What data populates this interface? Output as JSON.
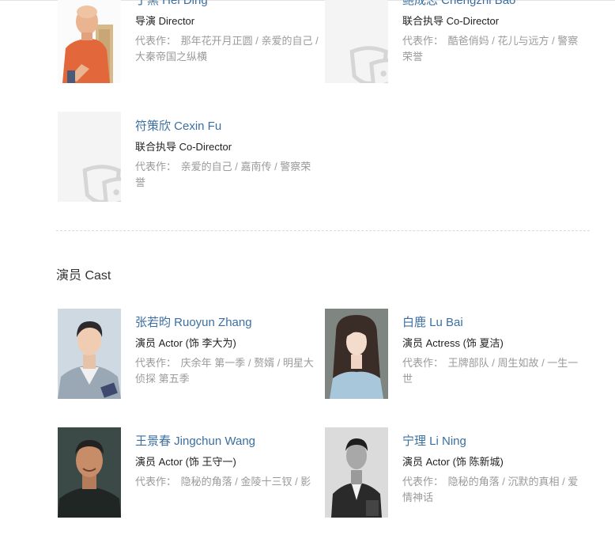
{
  "works_label": "代表作：",
  "crew": [
    {
      "name": "丁黑 Hei Ding",
      "role": "导演 Director",
      "works": "那年花开月正圆 / 亲爱的自己 / 大秦帝国之纵横",
      "photo": "director-portrait"
    },
    {
      "name": "鲍成志 Chengzhi Bao",
      "role": "联合执导 Co-Director",
      "works": "酷爸俏妈 / 花儿与远方 / 警察荣誉",
      "photo": "placeholder-masks-icon"
    },
    {
      "name": "符策欣 Cexin Fu",
      "role": "联合执导 Co-Director",
      "works": "亲爱的自己 / 嘉南传 / 警察荣誉",
      "photo": "placeholder-masks-icon"
    }
  ],
  "cast_title": "演员 Cast",
  "cast": [
    {
      "name": "张若昀 Ruoyun Zhang",
      "role": "演员 Actor (饰 李大为)",
      "works": "庆余年 第一季 / 赘婿 / 明星大侦探 第五季",
      "photo": "actor-portrait"
    },
    {
      "name": "白鹿 Lu Bai",
      "role": "演员 Actress (饰 夏洁)",
      "works": "王牌部队 / 周生如故 / 一生一世",
      "photo": "actress-portrait"
    },
    {
      "name": "王景春 Jingchun Wang",
      "role": "演员 Actor (饰 王守一)",
      "works": "隐秘的角落 / 金陵十三钗 / 影",
      "photo": "actor-portrait"
    },
    {
      "name": "宁理 Li Ning",
      "role": "演员 Actor (饰 陈新城)",
      "works": "隐秘的角落 / 沉默的真相 / 爱情神话",
      "photo": "actor-portrait-bw"
    }
  ]
}
